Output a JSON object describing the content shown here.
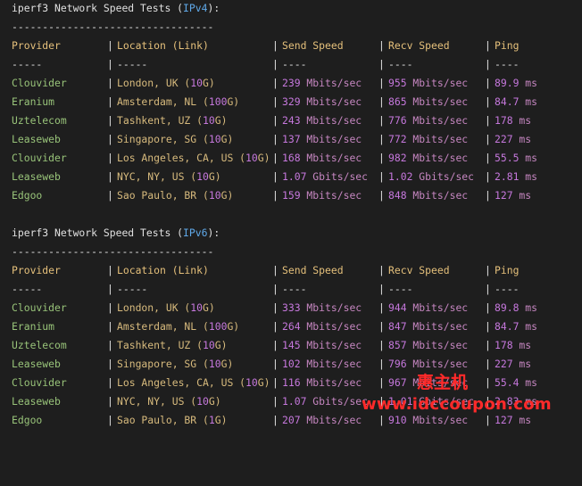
{
  "sections": [
    {
      "title_prefix": "iperf3 Network Speed Tests (",
      "title_proto": "IPv4",
      "title_suffix": "):",
      "dashes": "---------------------------------",
      "headers": [
        "Provider",
        "Location (Link)",
        "Send Speed",
        "Recv Speed",
        "Ping"
      ],
      "separators": [
        "-----",
        "-----",
        "----",
        "----",
        "----"
      ],
      "rows": [
        {
          "provider": "Clouvider",
          "location": "London, UK (10G)",
          "send": "239 Mbits/sec",
          "recv": "955 Mbits/sec",
          "ping": "89.9 ms"
        },
        {
          "provider": "Eranium",
          "location": "Amsterdam, NL (100G)",
          "send": "329 Mbits/sec",
          "recv": "865 Mbits/sec",
          "ping": "84.7 ms"
        },
        {
          "provider": "Uztelecom",
          "location": "Tashkent, UZ (10G)",
          "send": "243 Mbits/sec",
          "recv": "776 Mbits/sec",
          "ping": "178 ms"
        },
        {
          "provider": "Leaseweb",
          "location": "Singapore, SG (10G)",
          "send": "137 Mbits/sec",
          "recv": "772 Mbits/sec",
          "ping": "227 ms"
        },
        {
          "provider": "Clouvider",
          "location": "Los Angeles, CA, US (10G)",
          "send": "168 Mbits/sec",
          "recv": "982 Mbits/sec",
          "ping": "55.5 ms"
        },
        {
          "provider": "Leaseweb",
          "location": "NYC, NY, US (10G)",
          "send": "1.07 Gbits/sec",
          "recv": "1.02 Gbits/sec",
          "ping": "2.81 ms"
        },
        {
          "provider": "Edgoo",
          "location": "Sao Paulo, BR (10G)",
          "send": "159 Mbits/sec",
          "recv": "848 Mbits/sec",
          "ping": "127 ms"
        }
      ]
    },
    {
      "title_prefix": "iperf3 Network Speed Tests (",
      "title_proto": "IPv6",
      "title_suffix": "):",
      "dashes": "---------------------------------",
      "headers": [
        "Provider",
        "Location (Link)",
        "Send Speed",
        "Recv Speed",
        "Ping"
      ],
      "separators": [
        "-----",
        "-----",
        "----",
        "----",
        "----"
      ],
      "rows": [
        {
          "provider": "Clouvider",
          "location": "London, UK (10G)",
          "send": "333 Mbits/sec",
          "recv": "944 Mbits/sec",
          "ping": "89.8 ms"
        },
        {
          "provider": "Eranium",
          "location": "Amsterdam, NL (100G)",
          "send": "264 Mbits/sec",
          "recv": "847 Mbits/sec",
          "ping": "84.7 ms"
        },
        {
          "provider": "Uztelecom",
          "location": "Tashkent, UZ (10G)",
          "send": "145 Mbits/sec",
          "recv": "857 Mbits/sec",
          "ping": "178 ms"
        },
        {
          "provider": "Leaseweb",
          "location": "Singapore, SG (10G)",
          "send": "102 Mbits/sec",
          "recv": "796 Mbits/sec",
          "ping": "227 ms"
        },
        {
          "provider": "Clouvider",
          "location": "Los Angeles, CA, US (10G)",
          "send": "116 Mbits/sec",
          "recv": "967 Mbits/sec",
          "ping": "55.4 ms"
        },
        {
          "provider": "Leaseweb",
          "location": "NYC, NY, US (10G)",
          "send": "1.07 Gbits/sec",
          "recv": "1.01 Gbits/sec",
          "ping": "2.83 ms"
        },
        {
          "provider": "Edgoo",
          "location": "Sao Paulo, BR (1G)",
          "send": "207 Mbits/sec",
          "recv": "910 Mbits/sec",
          "ping": "127 ms"
        }
      ]
    }
  ],
  "watermark": {
    "line1": "惠主机",
    "line2": "www.idccoupon.com"
  }
}
